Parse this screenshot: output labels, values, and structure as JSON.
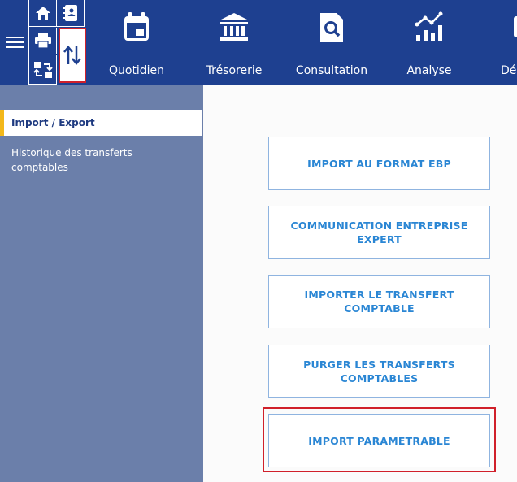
{
  "topbar": {
    "modules": [
      {
        "label": "Quotidien",
        "icon": "calendar-icon"
      },
      {
        "label": "Trésorerie",
        "icon": "bank-icon"
      },
      {
        "label": "Consultation",
        "icon": "document-search-icon"
      },
      {
        "label": "Analyse",
        "icon": "analytics-chart-icon"
      },
      {
        "label": "Déc",
        "icon": "partial-icon"
      }
    ],
    "quick_icons": [
      "home-icon",
      "contacts-icon",
      "print-icon",
      "import-export-icon",
      "transfer-icon"
    ]
  },
  "sidebar": {
    "active_item": "Import / Export",
    "items": [
      {
        "label": "Historique des transferts comptables"
      }
    ]
  },
  "main": {
    "buttons": [
      {
        "label": "IMPORT AU FORMAT EBP"
      },
      {
        "label": "COMMUNICATION ENTREPRISE EXPERT"
      },
      {
        "label": "IMPORTER LE TRANSFERT COMPTABLE"
      },
      {
        "label": "PURGER LES TRANSFERTS COMPTABLES"
      },
      {
        "label": "IMPORT PARAMETRABLE"
      }
    ]
  },
  "colors": {
    "topbar": "#1e4090",
    "sidebar": "#6b7faa",
    "accent": "#f3b81a",
    "button_text": "#2a86d4",
    "highlight": "#d0202a"
  }
}
